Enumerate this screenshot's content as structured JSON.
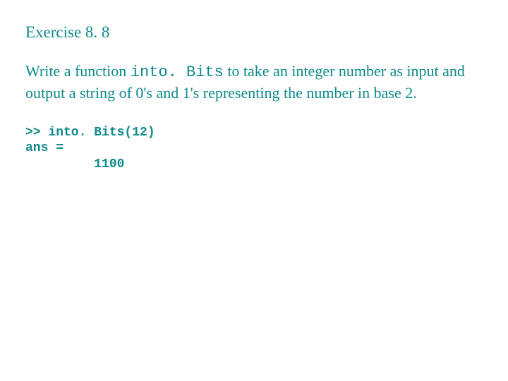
{
  "title": "Exercise 8. 8",
  "body": {
    "part1": "Write a function ",
    "code": "into. Bits",
    "part2": " to take an integer number as input and output a string of 0's and 1's representing the number in base 2."
  },
  "code_example": ">> into. Bits(12)\nans =\n         1100"
}
